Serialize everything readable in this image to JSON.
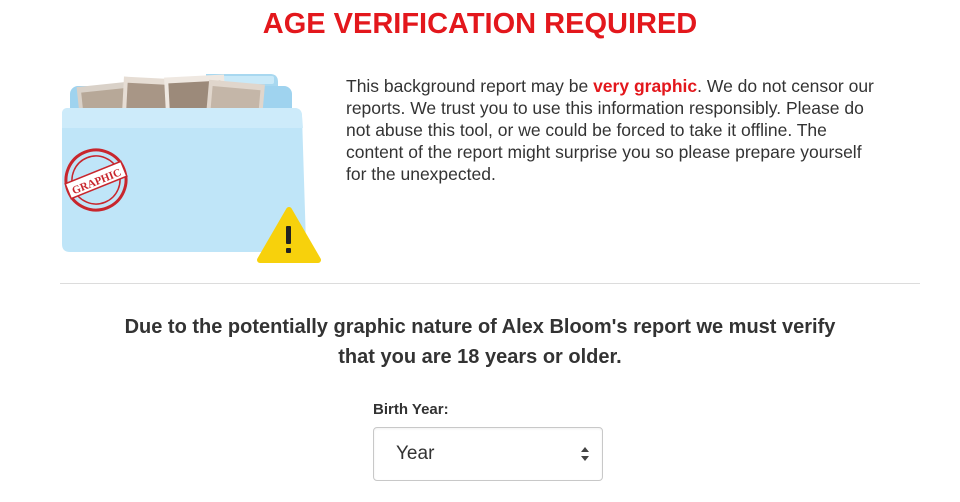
{
  "title": "AGE VERIFICATION REQUIRED",
  "warning": {
    "before": "This background report may be ",
    "emphasis": "very graphic",
    "after": ". We do not censor our reports. We trust you to use this information responsibly. Please do not abuse this tool, or we could be forced to take it offline. The content of the report might surprise you so please prepare yourself for the unexpected."
  },
  "illustration": {
    "stamp_text": "GRAPHIC",
    "icon_name": "folder-icon",
    "warning_icon_name": "warning-icon",
    "colors": {
      "folder": "#bfe5f8",
      "tab": "#9fd3ef",
      "stamp": "#c8262d",
      "warning": "#f7d10c"
    }
  },
  "notice": {
    "line1": "Due to the potentially graphic nature of Alex Bloom's report we must verify",
    "line2": "that you are 18 years or older."
  },
  "birth_year": {
    "label": "Birth Year:",
    "selected": "Year"
  },
  "colors": {
    "accent": "#e3171c",
    "text": "#333333",
    "divider": "#dcdcdc"
  }
}
